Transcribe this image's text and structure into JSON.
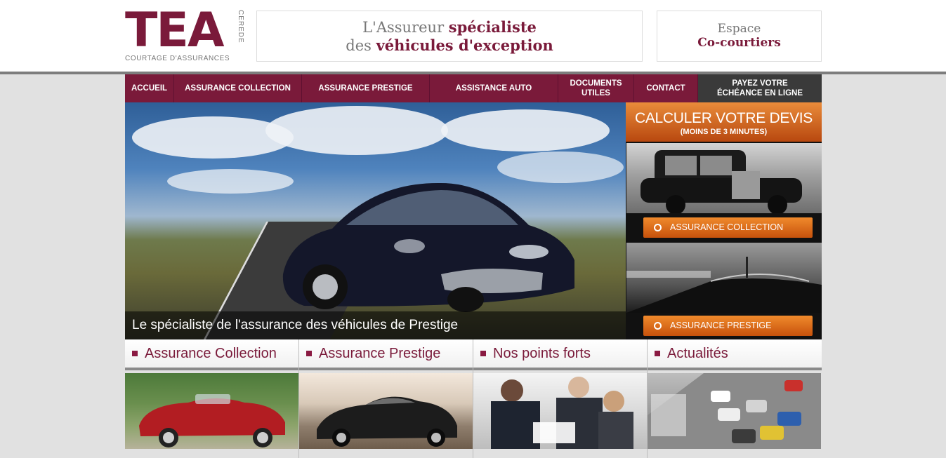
{
  "header": {
    "logo": {
      "letters": "TEA",
      "side_text": "CEREDE",
      "subtitle": "COURTAGE D'ASSURANCES"
    },
    "tagline": {
      "line1_normal": "L'Assureur",
      "line1_bold": "spécialiste",
      "line2_normal": "des",
      "line2_bold": "véhicules d'exception"
    },
    "cocourtiers": {
      "line1": "Espace",
      "line2": "Co-courtiers"
    }
  },
  "nav": {
    "items": [
      {
        "label": "ACCUEIL"
      },
      {
        "label": "ASSURANCE COLLECTION"
      },
      {
        "label": "ASSURANCE PRESTIGE"
      },
      {
        "label": "ASSISTANCE AUTO"
      },
      {
        "label": "DOCUMENTS UTILES"
      },
      {
        "label": "CONTACT"
      },
      {
        "label": "PAYEZ VOTRE ÉCHÉANCE EN LIGNE"
      }
    ]
  },
  "hero": {
    "caption": "Le spécialiste de l'assurance des véhicules de Prestige"
  },
  "devis": {
    "title": "CALCULER VOTRE DEVIS",
    "subtitle": "(MOINS DE 3 MINUTES)"
  },
  "ctas": [
    {
      "label": "ASSURANCE COLLECTION"
    },
    {
      "label": "ASSURANCE PRESTIGE"
    }
  ],
  "blocks": [
    {
      "title": "Assurance Collection"
    },
    {
      "title": "Assurance Prestige"
    },
    {
      "title": "Nos points forts"
    },
    {
      "title": "Actualités"
    }
  ],
  "colors": {
    "brand": "#7a1a3a",
    "accent_orange": "#e0701f",
    "nav_dark": "#3a3a3a"
  }
}
